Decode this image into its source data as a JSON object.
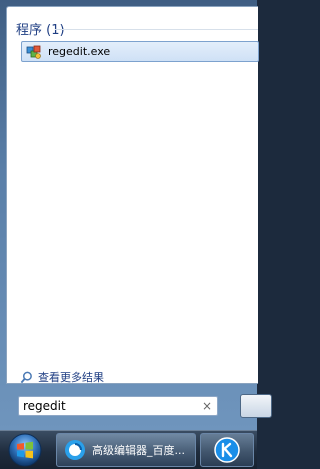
{
  "start_menu": {
    "section_header": "程序 (1)",
    "results": [
      {
        "label": "regedit.exe",
        "icon": "regedit-icon"
      }
    ],
    "see_more_label": "查看更多结果",
    "search": {
      "value": "regedit",
      "clear_glyph": "×"
    }
  },
  "taskbar": {
    "start_button_icon": "windows-logo-icon",
    "tasks": [
      {
        "label": "高级编辑器_百度...",
        "icon": "browser-icon"
      },
      {
        "label": "",
        "icon": "kugou-icon"
      }
    ]
  },
  "colors": {
    "link_blue": "#1f3e83",
    "highlight_border": "#7da2ce",
    "taskbar_dark": "#1f2c3d"
  }
}
